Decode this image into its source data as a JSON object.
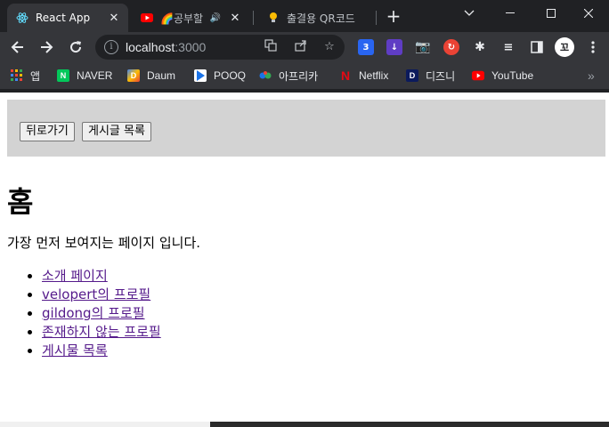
{
  "browser": {
    "tabs": [
      {
        "title": "React App",
        "icon": "react-icon",
        "active": true
      },
      {
        "title": "🌈공부할",
        "icon": "youtube-icon",
        "active": false
      },
      {
        "title": "출결용 QR코드",
        "icon": "lightbulb-icon",
        "active": false
      }
    ],
    "url_host": "localhost",
    "url_port": ":3000",
    "bookmarks": [
      {
        "label": "앱",
        "icon": "apps-grid-icon"
      },
      {
        "label": "NAVER",
        "icon": "naver-icon"
      },
      {
        "label": "Daum",
        "icon": "daum-icon"
      },
      {
        "label": "POOQ",
        "icon": "pooq-icon"
      },
      {
        "label": "아프리카",
        "icon": "afreeca-icon"
      },
      {
        "label": "Netflix",
        "icon": "netflix-icon"
      },
      {
        "label": "디즈니",
        "icon": "disney-icon"
      },
      {
        "label": "YouTube",
        "icon": "youtube-icon"
      }
    ],
    "profile_initial": "꼬"
  },
  "page": {
    "nav": {
      "back_label": "뒤로가기",
      "articles_label": "게시글 목록"
    },
    "heading": "홈",
    "description": "가장 먼저 보여지는 페이지 입니다.",
    "links": [
      "소개 페이지",
      "velopert의 프로필",
      "gildong의 프로필",
      "존재하지 않는 프로필",
      "게시물 목록"
    ]
  },
  "colors": {
    "chrome_bg": "#202124",
    "toolbar_bg": "#35363a",
    "navbar_bg": "#d3d3d3",
    "visited_link": "#551a8b"
  }
}
